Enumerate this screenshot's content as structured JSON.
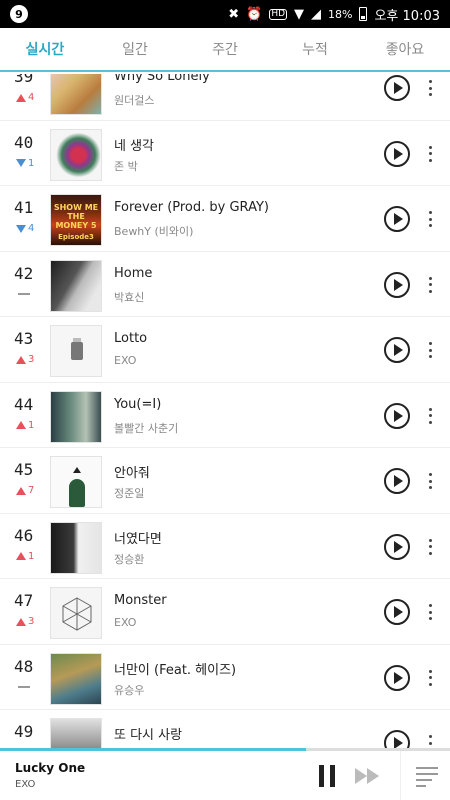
{
  "status_bar": {
    "app_badge": "9",
    "battery": "18%",
    "time": "오후 10:03"
  },
  "tabs": [
    {
      "label": "실시간",
      "active": true
    },
    {
      "label": "일간",
      "active": false
    },
    {
      "label": "주간",
      "active": false
    },
    {
      "label": "누적",
      "active": false
    },
    {
      "label": "좋아요",
      "active": false
    }
  ],
  "chart": [
    {
      "rank": "39",
      "change": "up",
      "change_value": "4",
      "title": "Why So Lonely",
      "artist": "원더걸스",
      "art": "a39"
    },
    {
      "rank": "40",
      "change": "down",
      "change_value": "1",
      "title": "네 생각",
      "artist": "존 박",
      "art": "a40"
    },
    {
      "rank": "41",
      "change": "down",
      "change_value": "4",
      "title": "Forever (Prod. by GRAY)",
      "artist": "BewhY (비와이)",
      "art": "a41"
    },
    {
      "rank": "42",
      "change": "same",
      "change_value": "",
      "title": "Home",
      "artist": "박효신",
      "art": "a42"
    },
    {
      "rank": "43",
      "change": "up",
      "change_value": "3",
      "title": "Lotto",
      "artist": "EXO",
      "art": "a43"
    },
    {
      "rank": "44",
      "change": "up",
      "change_value": "1",
      "title": "You(=I)",
      "artist": "볼빨간 사춘기",
      "art": "a44"
    },
    {
      "rank": "45",
      "change": "up",
      "change_value": "7",
      "title": "안아줘",
      "artist": "정준일",
      "art": "a45"
    },
    {
      "rank": "46",
      "change": "up",
      "change_value": "1",
      "title": "너였다면",
      "artist": "정승환",
      "art": "a46"
    },
    {
      "rank": "47",
      "change": "up",
      "change_value": "3",
      "title": "Monster",
      "artist": "EXO",
      "art": "a47"
    },
    {
      "rank": "48",
      "change": "same",
      "change_value": "",
      "title": "너만이 (Feat. 헤이즈)",
      "artist": "유승우",
      "art": "a48"
    },
    {
      "rank": "49",
      "change": "none",
      "change_value": "",
      "title": "또 다시 사랑",
      "artist": "",
      "art": "a49"
    }
  ],
  "album_labels": {
    "forever_cover": "SHOW ME THE MONEY 5",
    "forever_episode": "Episode3"
  },
  "now_playing": {
    "title": "Lucky One",
    "artist": "EXO",
    "progress": 0.68
  },
  "colors": {
    "accent": "#2aa9c2",
    "up": "#e8505b",
    "down": "#4a8fd1",
    "progress": "#4fc3d8"
  },
  "icons": {
    "status": [
      "mute-icon",
      "alarm-icon",
      "hd-icon",
      "wifi-icon",
      "signal-icon",
      "battery-icon"
    ],
    "row": [
      "play-icon",
      "more-icon"
    ],
    "player": [
      "pause-icon",
      "next-icon",
      "playlist-icon"
    ]
  }
}
